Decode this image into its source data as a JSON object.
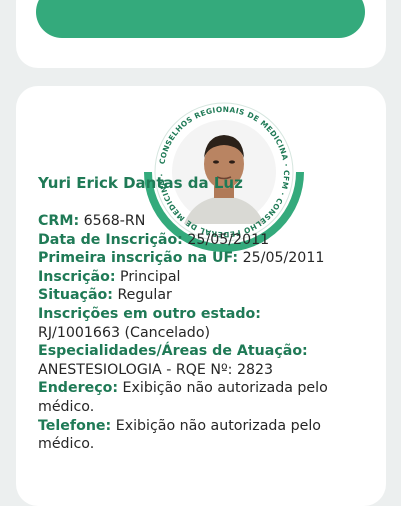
{
  "profile": {
    "seal_text": "CONSELHOS REGIONAIS DE MEDICINA · CFM · CONSELHO FEDERAL DE MEDICINA · CRMS ·",
    "name": "Yuri Erick Dantas da Luz",
    "fields": [
      {
        "label": "CRM:",
        "value": " 6568-RN"
      },
      {
        "label": "Data de Inscrição:",
        "value": " 25/05/2011"
      },
      {
        "label": "Primeira inscrição na UF:",
        "value": " 25/05/2011"
      },
      {
        "label": "Inscrição:",
        "value": " Principal"
      },
      {
        "label": "Situação:",
        "value": " Regular"
      },
      {
        "label": "Inscrições em outro estado:",
        "value": "RJ/1001663 (Cancelado)"
      },
      {
        "label": "Especialidades/Áreas de Atuação:",
        "value": "ANESTESIOLOGIA - RQE Nº: 2823"
      },
      {
        "label": "Endereço:",
        "value": " Exibição não autorizada pelo médico."
      },
      {
        "label": "Telefone:",
        "value": " Exibição não autorizada pelo médico."
      }
    ]
  },
  "colors": {
    "accent": "#34aa7c",
    "label": "#1f7a56",
    "text": "#262626",
    "background": "#ecefef"
  }
}
